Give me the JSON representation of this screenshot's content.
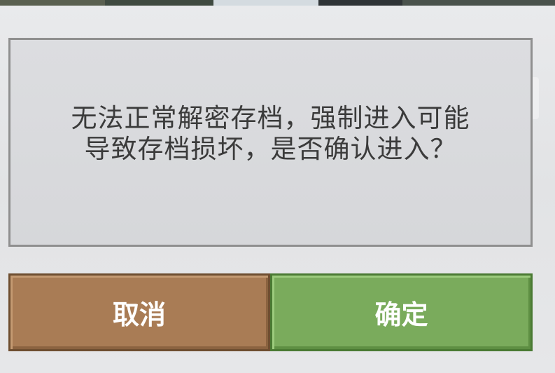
{
  "dialog": {
    "message": "无法正常解密存档，强制进入可能\n导致存档损坏，是否确认进入？"
  },
  "buttons": {
    "cancel_label": "取消",
    "confirm_label": "确定"
  },
  "colors": {
    "cancel_button": "#a97c55",
    "confirm_button": "#7aab5c",
    "panel_border": "#8f8f8f",
    "panel_background": "#d9dadd"
  }
}
